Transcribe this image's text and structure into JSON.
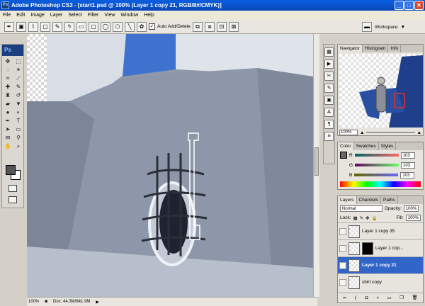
{
  "title": "Adobe Photoshop CS3 - [start1.psd @ 100% (Layer 1 copy 21, RGB/8#/CMYK)]",
  "menu": [
    "File",
    "Edit",
    "Image",
    "Layer",
    "Select",
    "Filter",
    "View",
    "Window",
    "Help"
  ],
  "options": {
    "auto_add_delete_label": "Auto Add/Delete",
    "auto_add_delete_checked": true
  },
  "workspace_label": "Workspace",
  "toolbox": {
    "logo": "Ps"
  },
  "status": {
    "zoom": "100%",
    "doc": "Doc: 44.3M/841.9M"
  },
  "navigator": {
    "tabs": [
      "Navigator",
      "Histogram",
      "Info"
    ],
    "zoom": "100%"
  },
  "color_panel": {
    "tabs": [
      "Color",
      "Swatches",
      "Styles"
    ],
    "rows": [
      {
        "label": "R",
        "value": "103"
      },
      {
        "label": "G",
        "value": "103"
      },
      {
        "label": "B",
        "value": "103"
      }
    ]
  },
  "layers_panel": {
    "tabs": [
      "Layers",
      "Channels",
      "Paths"
    ],
    "blend_mode": "Normal",
    "opacity_label": "Opacity:",
    "opacity": "100%",
    "lock_label": "Lock:",
    "fill_label": "Fill:",
    "fill": "100%",
    "layers": [
      {
        "name": "Layer 1 copy 35",
        "selected": false,
        "visible": false,
        "mask": false
      },
      {
        "name": "Layer 1 cop...",
        "selected": false,
        "visible": false,
        "mask": true
      },
      {
        "name": "Layer 1 copy 21",
        "selected": true,
        "visible": true,
        "mask": false
      },
      {
        "name": "shirt copy",
        "selected": false,
        "visible": false,
        "mask": false
      }
    ]
  },
  "colors": {
    "selection": "#3166c8",
    "title_bar": "#0a5fe0"
  }
}
